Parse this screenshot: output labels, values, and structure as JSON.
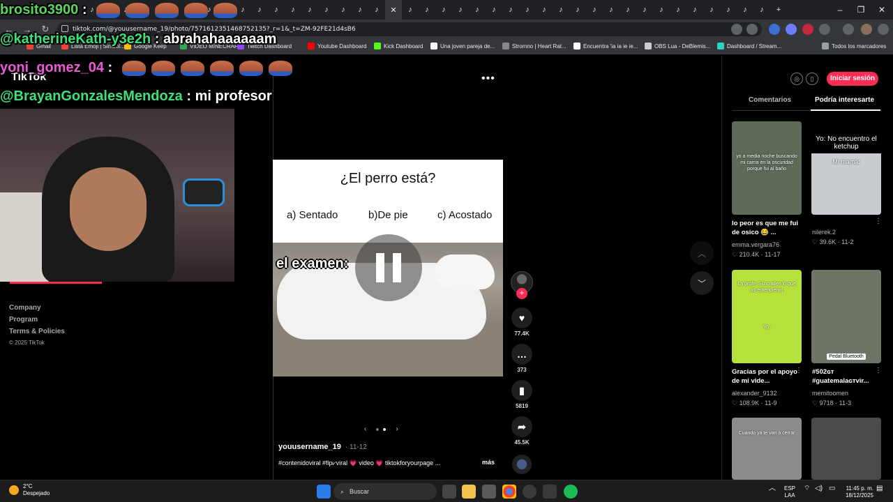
{
  "browser": {
    "url": "tiktok.com/@youusername_19/photo/7571612351468752135?_r=1&_t=ZM-92FE21d4sB6",
    "bookmarks": [
      {
        "label": "Gmail",
        "color": "#ea4335"
      },
      {
        "label": "Lista Emoji | Simbol...",
        "color": "#f44336"
      },
      {
        "label": "Google Keep",
        "color": "#fbbc04"
      },
      {
        "label": "VIDEO MINECRAFT",
        "color": "#34a853"
      },
      {
        "label": "Twitch Dashboard",
        "color": "#9146ff"
      },
      {
        "label": "Youtube Dashboard",
        "color": "#ff0000"
      },
      {
        "label": "Kick Dashboard",
        "color": "#53fc18"
      },
      {
        "label": "Una joven pareja de...",
        "color": "#ffffff"
      },
      {
        "label": "Stromno | Heart Rat...",
        "color": "#888888"
      },
      {
        "label": "Encuentra 'ia ia ie ie...",
        "color": "#ffffff"
      },
      {
        "label": "OBS Lua - DeBlemis...",
        "color": "#cccccc"
      },
      {
        "label": "Dashboard / Stream...",
        "color": "#2dd4bf"
      }
    ],
    "all_bookmarks": "Todos los marcadores",
    "window_controls": {
      "minimize": "–",
      "maximize": "❐",
      "close": "✕"
    }
  },
  "tiktok": {
    "logo": "TikTok",
    "footer_links": [
      "Company",
      "Program",
      "Terms & Policies"
    ],
    "copyright": "© 2025 TikTok",
    "more_menu": "•••",
    "post": {
      "question": "¿El perro está?",
      "options": [
        "a) Sentado",
        "b)De pie",
        "c) Acostado"
      ],
      "overlay_text": "el examen:",
      "author": "youusername_19",
      "date": "11-12",
      "caption": "#contenidoviral #fip⩗viral 💗 video 💗 tiktokforyourpage ...",
      "more": "más",
      "likes": "77.4K",
      "comments": "373",
      "saves": "5819",
      "shares": "45.5K"
    },
    "login_button": "Iniciar sesión",
    "tabs": [
      "Comentarios",
      "Podría interesarte"
    ],
    "cards": [
      {
        "thumb_text": "yo a media noche buscando mi cama en la oscuridad porque fui al baño",
        "title": "lo peor es que me fui de osico 😂 ...",
        "author": "emma.vergara76",
        "likes": "210.4K",
        "date": "11-17",
        "bg": "#5d6b58"
      },
      {
        "thumb_text": "Yo: No encuentro el ketchup",
        "thumb_text2": "Mi mamá:",
        "title": "",
        "author": "nilerek.2",
        "likes": "39.6K",
        "date": "11-2",
        "bg": "#c8ccd0"
      },
      {
        "thumb_text": "La profe: Si no allen lo que no entendieron",
        "thumb_text2": "Yo:",
        "title": "Gracias por el apoyo de mi vide...",
        "author": "alexander_9132",
        "likes": "108.9K",
        "date": "11-9",
        "bg": "#b6e03a"
      },
      {
        "thumb_text": "Pedal Bluetooth",
        "title": "#502ɢᴛ #guatemalaɢᴛvir...",
        "author": "memitoomen",
        "likes": "9718",
        "date": "11-3",
        "bg": "#6d7566"
      },
      {
        "thumb_text": "Cuando ya te van a cerrar",
        "title": "",
        "author": "",
        "likes": "",
        "date": "",
        "bg": "#8a8d8a"
      },
      {
        "thumb_text": "",
        "title": "",
        "author": "",
        "likes": "",
        "date": "",
        "bg": "#4a4a4a"
      }
    ]
  },
  "stream_overlay": {
    "chat": [
      {
        "user": "brosito3900",
        "text": "",
        "color": "#5cd65c"
      },
      {
        "user": "@katherineKath-y3e2h",
        "text": "abrahahaaaaaam",
        "color": "#3ee07a"
      },
      {
        "user": "yoni_gomez_04",
        "text": "",
        "color": "#e85bd5"
      },
      {
        "user": "@BrayanGonzalesMendoza",
        "text": "mi profesor",
        "color": "#3ee07a"
      }
    ]
  },
  "taskbar": {
    "temperature": "2°C",
    "weather": "Despejado",
    "search": "Buscar",
    "lang": "ESP",
    "lang2": "LAA",
    "time": "11:45 p. m.",
    "date": "18/12/2025"
  }
}
